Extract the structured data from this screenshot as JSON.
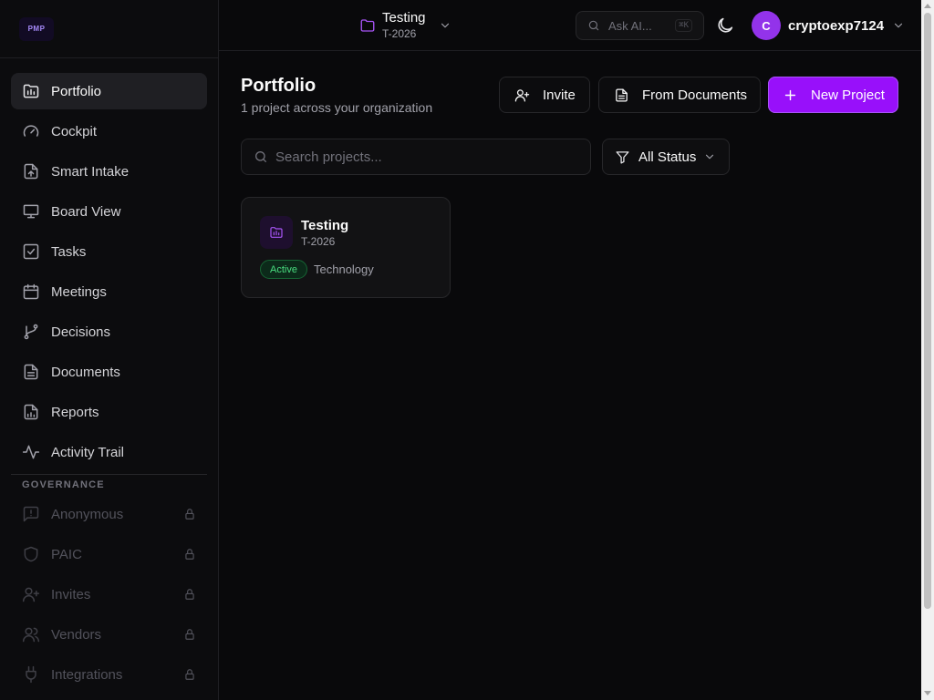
{
  "app": {
    "logo_text": "PMP"
  },
  "sidebar": {
    "nav": [
      {
        "label": "Portfolio",
        "icon": "portfolio-icon",
        "active": true
      },
      {
        "label": "Cockpit",
        "icon": "gauge-icon"
      },
      {
        "label": "Smart Intake",
        "icon": "file-upload-icon"
      },
      {
        "label": "Board View",
        "icon": "presentation-icon"
      },
      {
        "label": "Tasks",
        "icon": "check-square-icon"
      },
      {
        "label": "Meetings",
        "icon": "calendar-icon"
      },
      {
        "label": "Decisions",
        "icon": "git-branch-icon"
      },
      {
        "label": "Documents",
        "icon": "document-icon"
      },
      {
        "label": "Reports",
        "icon": "report-icon"
      },
      {
        "label": "Activity Trail",
        "icon": "activity-icon"
      }
    ],
    "governance_heading": "GOVERNANCE",
    "governance": [
      {
        "label": "Anonymous",
        "icon": "message-alert-icon",
        "locked": true
      },
      {
        "label": "PAIC",
        "icon": "shield-icon",
        "locked": true
      },
      {
        "label": "Invites",
        "icon": "user-plus-icon",
        "locked": true
      },
      {
        "label": "Vendors",
        "icon": "users-icon",
        "locked": true
      },
      {
        "label": "Integrations",
        "icon": "plug-icon",
        "locked": true
      }
    ]
  },
  "topbar": {
    "project_name": "Testing",
    "project_code": "T-2026",
    "ask_ai_placeholder": "Ask AI...",
    "ask_ai_shortcut": "⌘K",
    "user_initial": "C",
    "username": "cryptoexp7124"
  },
  "main": {
    "title": "Portfolio",
    "subtitle": "1 project across your organization",
    "buttons": {
      "invite": "Invite",
      "from_documents": "From Documents",
      "new_project": "New Project"
    },
    "search_placeholder": "Search projects...",
    "status_filter": "All Status",
    "projects": [
      {
        "name": "Testing",
        "code": "T-2026",
        "status": "Active",
        "category": "Technology"
      }
    ]
  },
  "colors": {
    "accent": "#9810fa",
    "active_status": "#4ade80"
  }
}
